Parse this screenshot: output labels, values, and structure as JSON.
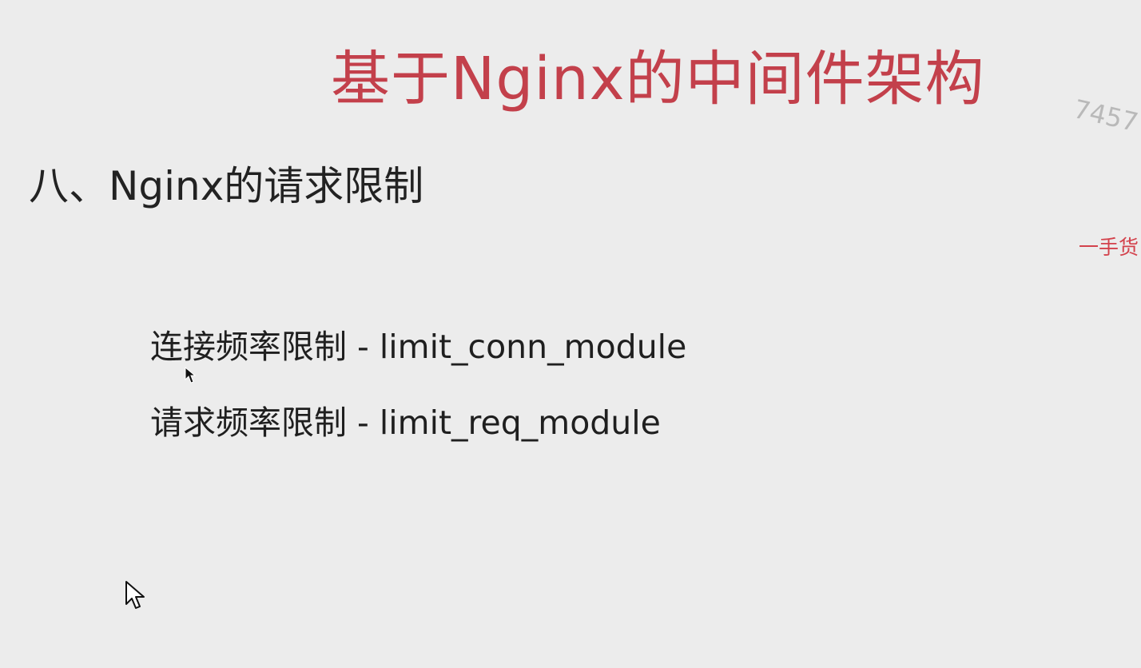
{
  "slide": {
    "title": "基于Nginx的中间件架构",
    "section_heading": "八、Nginx的请求限制",
    "bullets": [
      "连接频率限制 - limit_conn_module",
      "请求频率限制 - limit_req_module"
    ],
    "watermark_number": "7457",
    "watermark_text": "一手货"
  },
  "colors": {
    "background": "#ececec",
    "title": "#c3404b",
    "body_text": "#222222",
    "watermark_red": "#d3424c",
    "watermark_gray": "#b9b9b9"
  },
  "icons": {
    "cursor_large": "pointer-cursor-icon",
    "cursor_small": "pointer-cursor-icon"
  }
}
